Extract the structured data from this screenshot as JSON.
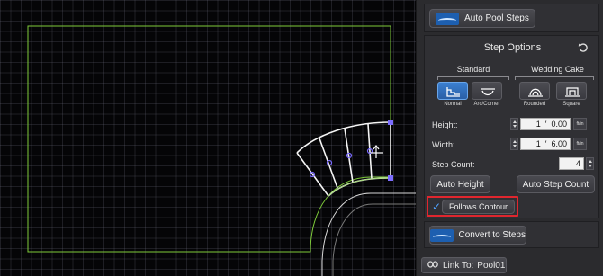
{
  "panel": {
    "auto_pool_steps": "Auto Pool Steps",
    "step_options_title": "Step Options",
    "reset_icon": "reset-icon",
    "groups": {
      "standard": "Standard",
      "wedding_cake": "Wedding Cake"
    },
    "step_types": [
      {
        "label": "Normal",
        "selected": true
      },
      {
        "label": "Arc/Corner",
        "selected": false
      },
      {
        "label": "Rounded",
        "selected": false
      },
      {
        "label": "Square",
        "selected": false
      }
    ],
    "height": {
      "label": "Height:",
      "feet": "1",
      "inches": "0.00",
      "unit": "ft/in"
    },
    "width": {
      "label": "Width:",
      "feet": "1",
      "inches": "6.00",
      "unit": "ft/in"
    },
    "step_count": {
      "label": "Step Count:",
      "value": "4"
    },
    "auto_height": "Auto Height",
    "auto_step_count": "Auto Step Count",
    "follows_contour": {
      "label": "Follows Contour",
      "checked": true
    },
    "convert_to_steps": "Convert to Steps",
    "link_to": {
      "label": "Link To:",
      "value": "Pool01"
    }
  },
  "colors": {
    "accent": "#2a6fd0",
    "highlight_border": "#e0262e",
    "pool_outline": "#7ecb3a",
    "handle": "#7b6cff"
  }
}
